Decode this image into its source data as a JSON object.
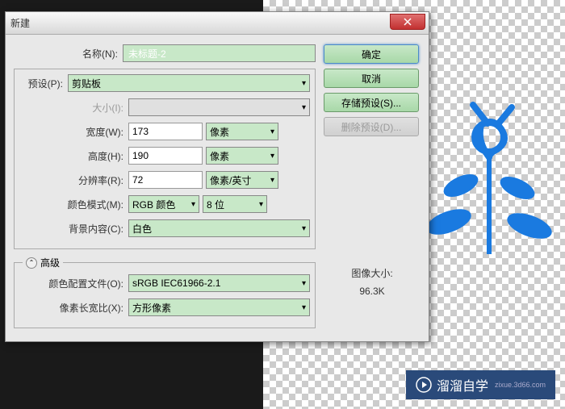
{
  "titlebar": {
    "title": "新建"
  },
  "name": {
    "label": "名称(N):",
    "value": "未标题-2"
  },
  "preset": {
    "label": "预设(P):",
    "value": "剪贴板"
  },
  "size": {
    "label": "大小(I):",
    "value": ""
  },
  "width": {
    "label": "宽度(W):",
    "value": "173",
    "unit": "像素"
  },
  "height": {
    "label": "高度(H):",
    "value": "190",
    "unit": "像素"
  },
  "resolution": {
    "label": "分辨率(R):",
    "value": "72",
    "unit": "像素/英寸"
  },
  "colorMode": {
    "label": "颜色模式(M):",
    "value": "RGB 颜色",
    "depth": "8 位"
  },
  "bgContent": {
    "label": "背景内容(C):",
    "value": "白色"
  },
  "advanced": {
    "label": "高级"
  },
  "colorProfile": {
    "label": "颜色配置文件(O):",
    "value": "sRGB IEC61966-2.1"
  },
  "pixelRatio": {
    "label": "像素长宽比(X):",
    "value": "方形像素"
  },
  "buttons": {
    "ok": "确定",
    "cancel": "取消",
    "save": "存储预设(S)...",
    "delete": "删除预设(D)..."
  },
  "imageSize": {
    "label": "图像大小:",
    "value": "96.3K"
  },
  "watermark": {
    "text": "溜溜自学",
    "sub": "zixue.3d66.com"
  }
}
